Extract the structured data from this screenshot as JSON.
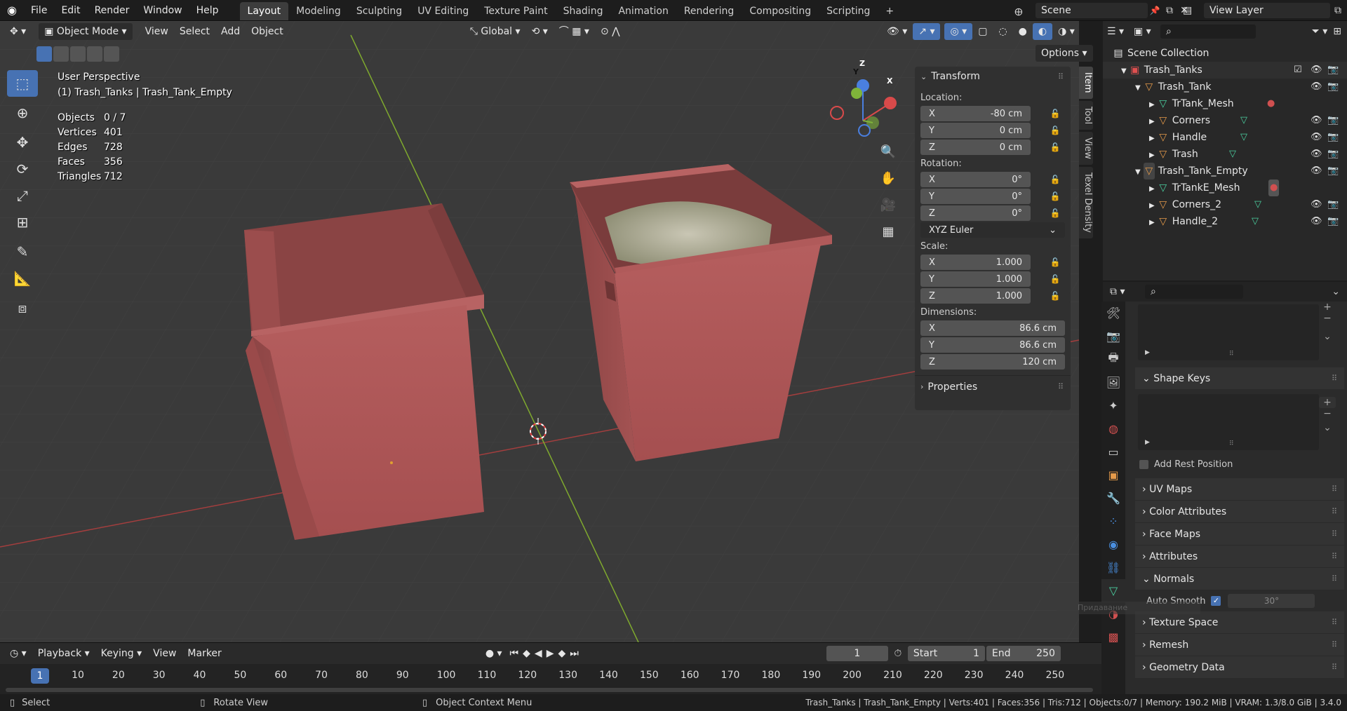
{
  "topbar": {
    "menus": [
      "File",
      "Edit",
      "Render",
      "Window",
      "Help"
    ],
    "workspaces": [
      "Layout",
      "Modeling",
      "Sculpting",
      "UV Editing",
      "Texture Paint",
      "Shading",
      "Animation",
      "Rendering",
      "Compositing",
      "Scripting"
    ],
    "active_workspace": "Layout",
    "plus": "+",
    "scene": "Scene",
    "view_layer": "View Layer"
  },
  "viewport_header": {
    "mode": "Object Mode",
    "menus": [
      "View",
      "Select",
      "Add",
      "Object"
    ],
    "orientation": "Global",
    "options": "Options"
  },
  "overlay": {
    "perspective": "User Perspective",
    "active": "(1) Trash_Tanks | Trash_Tank_Empty",
    "stats": [
      {
        "label": "Objects",
        "value": "0 / 7"
      },
      {
        "label": "Vertices",
        "value": "401"
      },
      {
        "label": "Edges",
        "value": "728"
      },
      {
        "label": "Faces",
        "value": "356"
      },
      {
        "label": "Triangles",
        "value": "712"
      }
    ]
  },
  "gizmo": {
    "x": "X",
    "y": "Y",
    "z": "Z"
  },
  "npanel": {
    "title": "Transform",
    "location_label": "Location:",
    "location": [
      {
        "axis": "X",
        "value": "-80 cm"
      },
      {
        "axis": "Y",
        "value": "0 cm"
      },
      {
        "axis": "Z",
        "value": "0 cm"
      }
    ],
    "rotation_label": "Rotation:",
    "rotation": [
      {
        "axis": "X",
        "value": "0°"
      },
      {
        "axis": "Y",
        "value": "0°"
      },
      {
        "axis": "Z",
        "value": "0°"
      }
    ],
    "rotation_mode": "XYZ Euler",
    "scale_label": "Scale:",
    "scale": [
      {
        "axis": "X",
        "value": "1.000"
      },
      {
        "axis": "Y",
        "value": "1.000"
      },
      {
        "axis": "Z",
        "value": "1.000"
      }
    ],
    "dimensions_label": "Dimensions:",
    "dimensions": [
      {
        "axis": "X",
        "value": "86.6 cm"
      },
      {
        "axis": "Y",
        "value": "86.6 cm"
      },
      {
        "axis": "Z",
        "value": "120 cm"
      }
    ],
    "properties": "Properties",
    "tabs": [
      "Item",
      "Tool",
      "View",
      "Texel Density"
    ]
  },
  "outliner": {
    "root": "Scene Collection",
    "items": [
      "Trash_Tanks",
      "Trash_Tank",
      "TrTank_Mesh",
      "Corners",
      "Handle",
      "Trash",
      "Trash_Tank_Empty",
      "TrTankE_Mesh",
      "Corners_2",
      "Handle_2"
    ]
  },
  "props": {
    "shape_keys": "Shape Keys",
    "add_rest": "Add Rest Position",
    "sections": [
      "UV Maps",
      "Color Attributes",
      "Face Maps",
      "Attributes"
    ],
    "normals": "Normals",
    "auto_smooth": "Auto Smooth",
    "auto_smooth_angle": "30°",
    "sections2": [
      "Texture Space",
      "Remesh",
      "Geometry Data"
    ],
    "tooltip": "Придавание"
  },
  "timeline": {
    "menus": [
      "Playback",
      "Keying",
      "View",
      "Marker"
    ],
    "current_frame": "1",
    "start_label": "Start",
    "start": "1",
    "end_label": "End",
    "end": "250",
    "ticks": [
      "1",
      "10",
      "20",
      "30",
      "40",
      "50",
      "60",
      "70",
      "80",
      "90",
      "100",
      "110",
      "120",
      "130",
      "140",
      "150",
      "160",
      "170",
      "180",
      "190",
      "200",
      "210",
      "220",
      "230",
      "240",
      "250"
    ]
  },
  "status": {
    "select": "Select",
    "rotate": "Rotate View",
    "context": "Object Context Menu",
    "info": "Trash_Tanks | Trash_Tank_Empty | Verts:401 | Faces:356 | Tris:712 | Objects:0/7 | Memory: 190.2 MiB | VRAM: 1.3/8.0 GiB | 3.4.0"
  },
  "colors": {
    "accent": "#4772b3",
    "tank": "#b15a5a",
    "x_axis": "#d94a4a",
    "y_axis": "#7fb33a",
    "z_axis": "#4a7fe0"
  }
}
